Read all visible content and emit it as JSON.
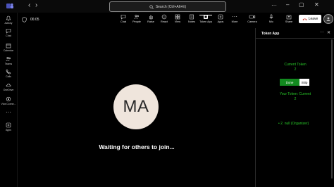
{
  "titlebar": {
    "search_placeholder": "Search (Ctrl+Alt+E)",
    "more_icon": "more-icon",
    "window_controls": [
      "minimize",
      "maximize",
      "close"
    ]
  },
  "rail": {
    "items": [
      {
        "label": "Activity",
        "icon": "bell-icon"
      },
      {
        "label": "Chat",
        "icon": "chat-icon"
      },
      {
        "label": "Calendar",
        "icon": "calendar-icon"
      },
      {
        "label": "Teams",
        "icon": "teams-icon"
      },
      {
        "label": "Calls",
        "icon": "phone-icon"
      },
      {
        "label": "OneDrive",
        "icon": "cloud-icon"
      },
      {
        "label": "Viva Conne...",
        "icon": "viva-icon"
      },
      {
        "label": "",
        "icon": "more-icon"
      },
      {
        "label": "Apps",
        "icon": "apps-icon"
      }
    ]
  },
  "meeting": {
    "timer": "06:05",
    "toolbar": {
      "chat": "Chat",
      "people": "People",
      "raise": "Raise",
      "react": "React",
      "view": "View",
      "notes": "Notes",
      "token_app": "Token App",
      "apps": "Apps",
      "more": "More",
      "camera": "Camera",
      "mic": "Mic",
      "share": "Share",
      "leave": "Leave"
    },
    "participant_initials": "MA",
    "waiting_text": "Waiting for others to join..."
  },
  "panel": {
    "title": "Token App",
    "current_token_label": "Current Token",
    "current_token_value": "2",
    "done_label": "Done",
    "skip_label": "Skip",
    "your_token_label": "Your Token: Current",
    "your_token_value": "2",
    "queue": [
      "2. null (Organizer)"
    ]
  },
  "colors": {
    "accent_green": "#28c828",
    "done_button": "#128a1f",
    "avatar_bg": "#efe5dc"
  }
}
